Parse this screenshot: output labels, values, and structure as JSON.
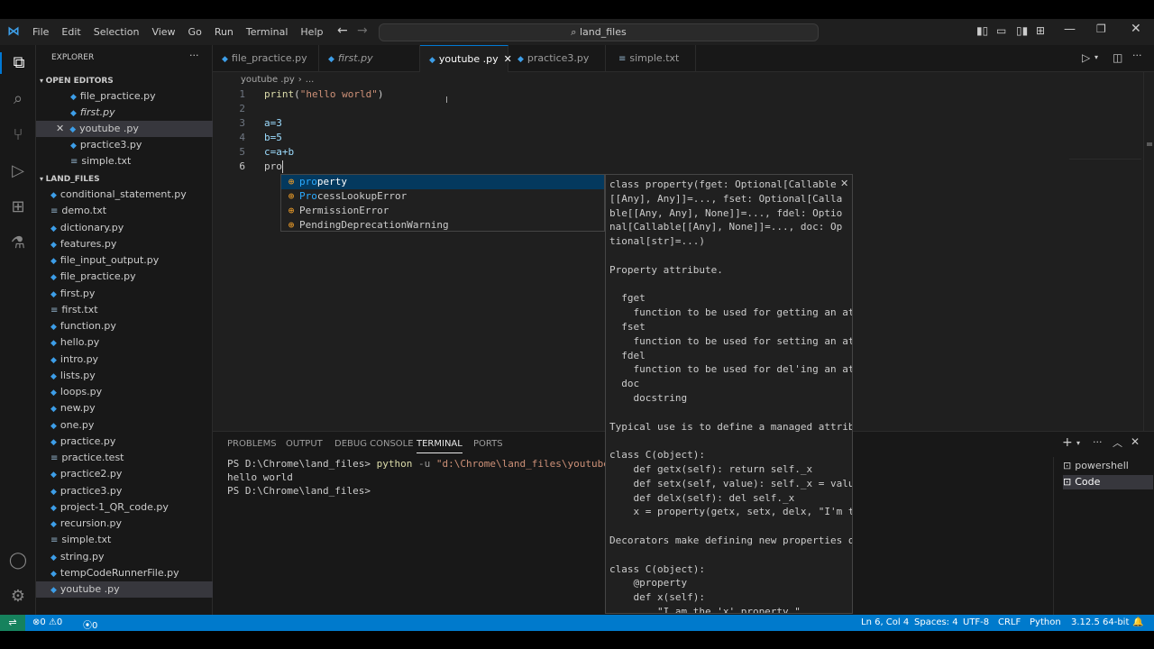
{
  "titlebar": {
    "menu": [
      "File",
      "Edit",
      "Selection",
      "View",
      "Go",
      "Run",
      "Terminal",
      "Help"
    ],
    "command_center": "land_files"
  },
  "sidebar": {
    "title": "EXPLORER",
    "open_editors_title": "OPEN EDITORS",
    "open_editors": [
      "file_practice.py",
      "first.py",
      "youtube .py",
      "practice3.py",
      "simple.txt"
    ],
    "folder_title": "LAND_FILES",
    "files": [
      "conditional_statement.py",
      "demo.txt",
      "dictionary.py",
      "features.py",
      "file_input_output.py",
      "file_practice.py",
      "first.py",
      "first.txt",
      "function.py",
      "hello.py",
      "intro.py",
      "lists.py",
      "loops.py",
      "new.py",
      "one.py",
      "practice.py",
      "practice.test",
      "practice2.py",
      "practice3.py",
      "project-1_QR_code.py",
      "recursion.py",
      "simple.txt",
      "string.py",
      "tempCodeRunnerFile.py",
      "youtube .py"
    ]
  },
  "tabs": [
    "file_practice.py",
    "first.py",
    "youtube .py",
    "practice3.py",
    "simple.txt"
  ],
  "breadcrumb": [
    "youtube .py",
    "..."
  ],
  "editor": {
    "lines": [
      {
        "n": "1",
        "code": "print(\"hello world\")"
      },
      {
        "n": "2",
        "code": ""
      },
      {
        "n": "3",
        "code": "a=3"
      },
      {
        "n": "4",
        "code": "b=5"
      },
      {
        "n": "5",
        "code": "c=a+b"
      },
      {
        "n": "6",
        "code": "pro"
      }
    ]
  },
  "suggestions": [
    {
      "match": "pro",
      "rest": "perty"
    },
    {
      "match": "Pro",
      "rest": "cessLookupError"
    },
    {
      "match": "",
      "rest": "PermissionError"
    },
    {
      "match": "",
      "rest": "PendingDeprecationWarning"
    }
  ],
  "doc_lines": [
    "class property(fget: Optional[Callable",
    "[[Any], Any]]=..., fset: Optional[Calla",
    "ble[[Any, Any], None]]=..., fdel: Optio",
    "nal[Callable[[Any], None]]=..., doc: Op",
    "tional[str]=...)",
    "",
    "Property attribute.",
    "",
    "  fget",
    "    function to be used for getting an att",
    "  fset",
    "    function to be used for setting an att",
    "  fdel",
    "    function to be used for del'ing an att",
    "  doc",
    "    docstring",
    "",
    "Typical use is to define a managed attribu",
    "",
    "class C(object):",
    "    def getx(self): return self._x",
    "    def setx(self, value): self._x = value",
    "    def delx(self): del self._x",
    "    x = property(getx, setx, delx, \"I'm the",
    "",
    "Decorators make defining new properties or",
    "",
    "class C(object):",
    "    @property",
    "    def x(self):",
    "        \"I am the 'x' property.\""
  ],
  "panel": {
    "tabs": [
      "PROBLEMS",
      "OUTPUT",
      "DEBUG CONSOLE",
      "TERMINAL",
      "PORTS"
    ],
    "terminal_lines": [
      {
        "prompt": "PS D:\\Chrome\\land_files> ",
        "cmd": "python",
        "flag": " -u ",
        "arg": "\"d:\\Chrome\\land_files\\youtube .py\""
      },
      {
        "prompt": "hello world",
        "cmd": "",
        "flag": "",
        "arg": ""
      },
      {
        "prompt": "PS D:\\Chrome\\land_files> ",
        "cmd": "",
        "flag": "",
        "arg": ""
      }
    ],
    "terminals": [
      "powershell",
      "Code"
    ]
  },
  "statusbar": {
    "errors": "0",
    "warnings": "0",
    "ports": "0",
    "position": "Ln 6, Col 4",
    "spaces": "Spaces: 4",
    "encoding": "UTF-8",
    "eol": "CRLF",
    "language": "Python",
    "interpreter": "3.12.5 64-bit"
  },
  "colors": {
    "accent": "#007acc",
    "keyword": "#ce9178"
  }
}
